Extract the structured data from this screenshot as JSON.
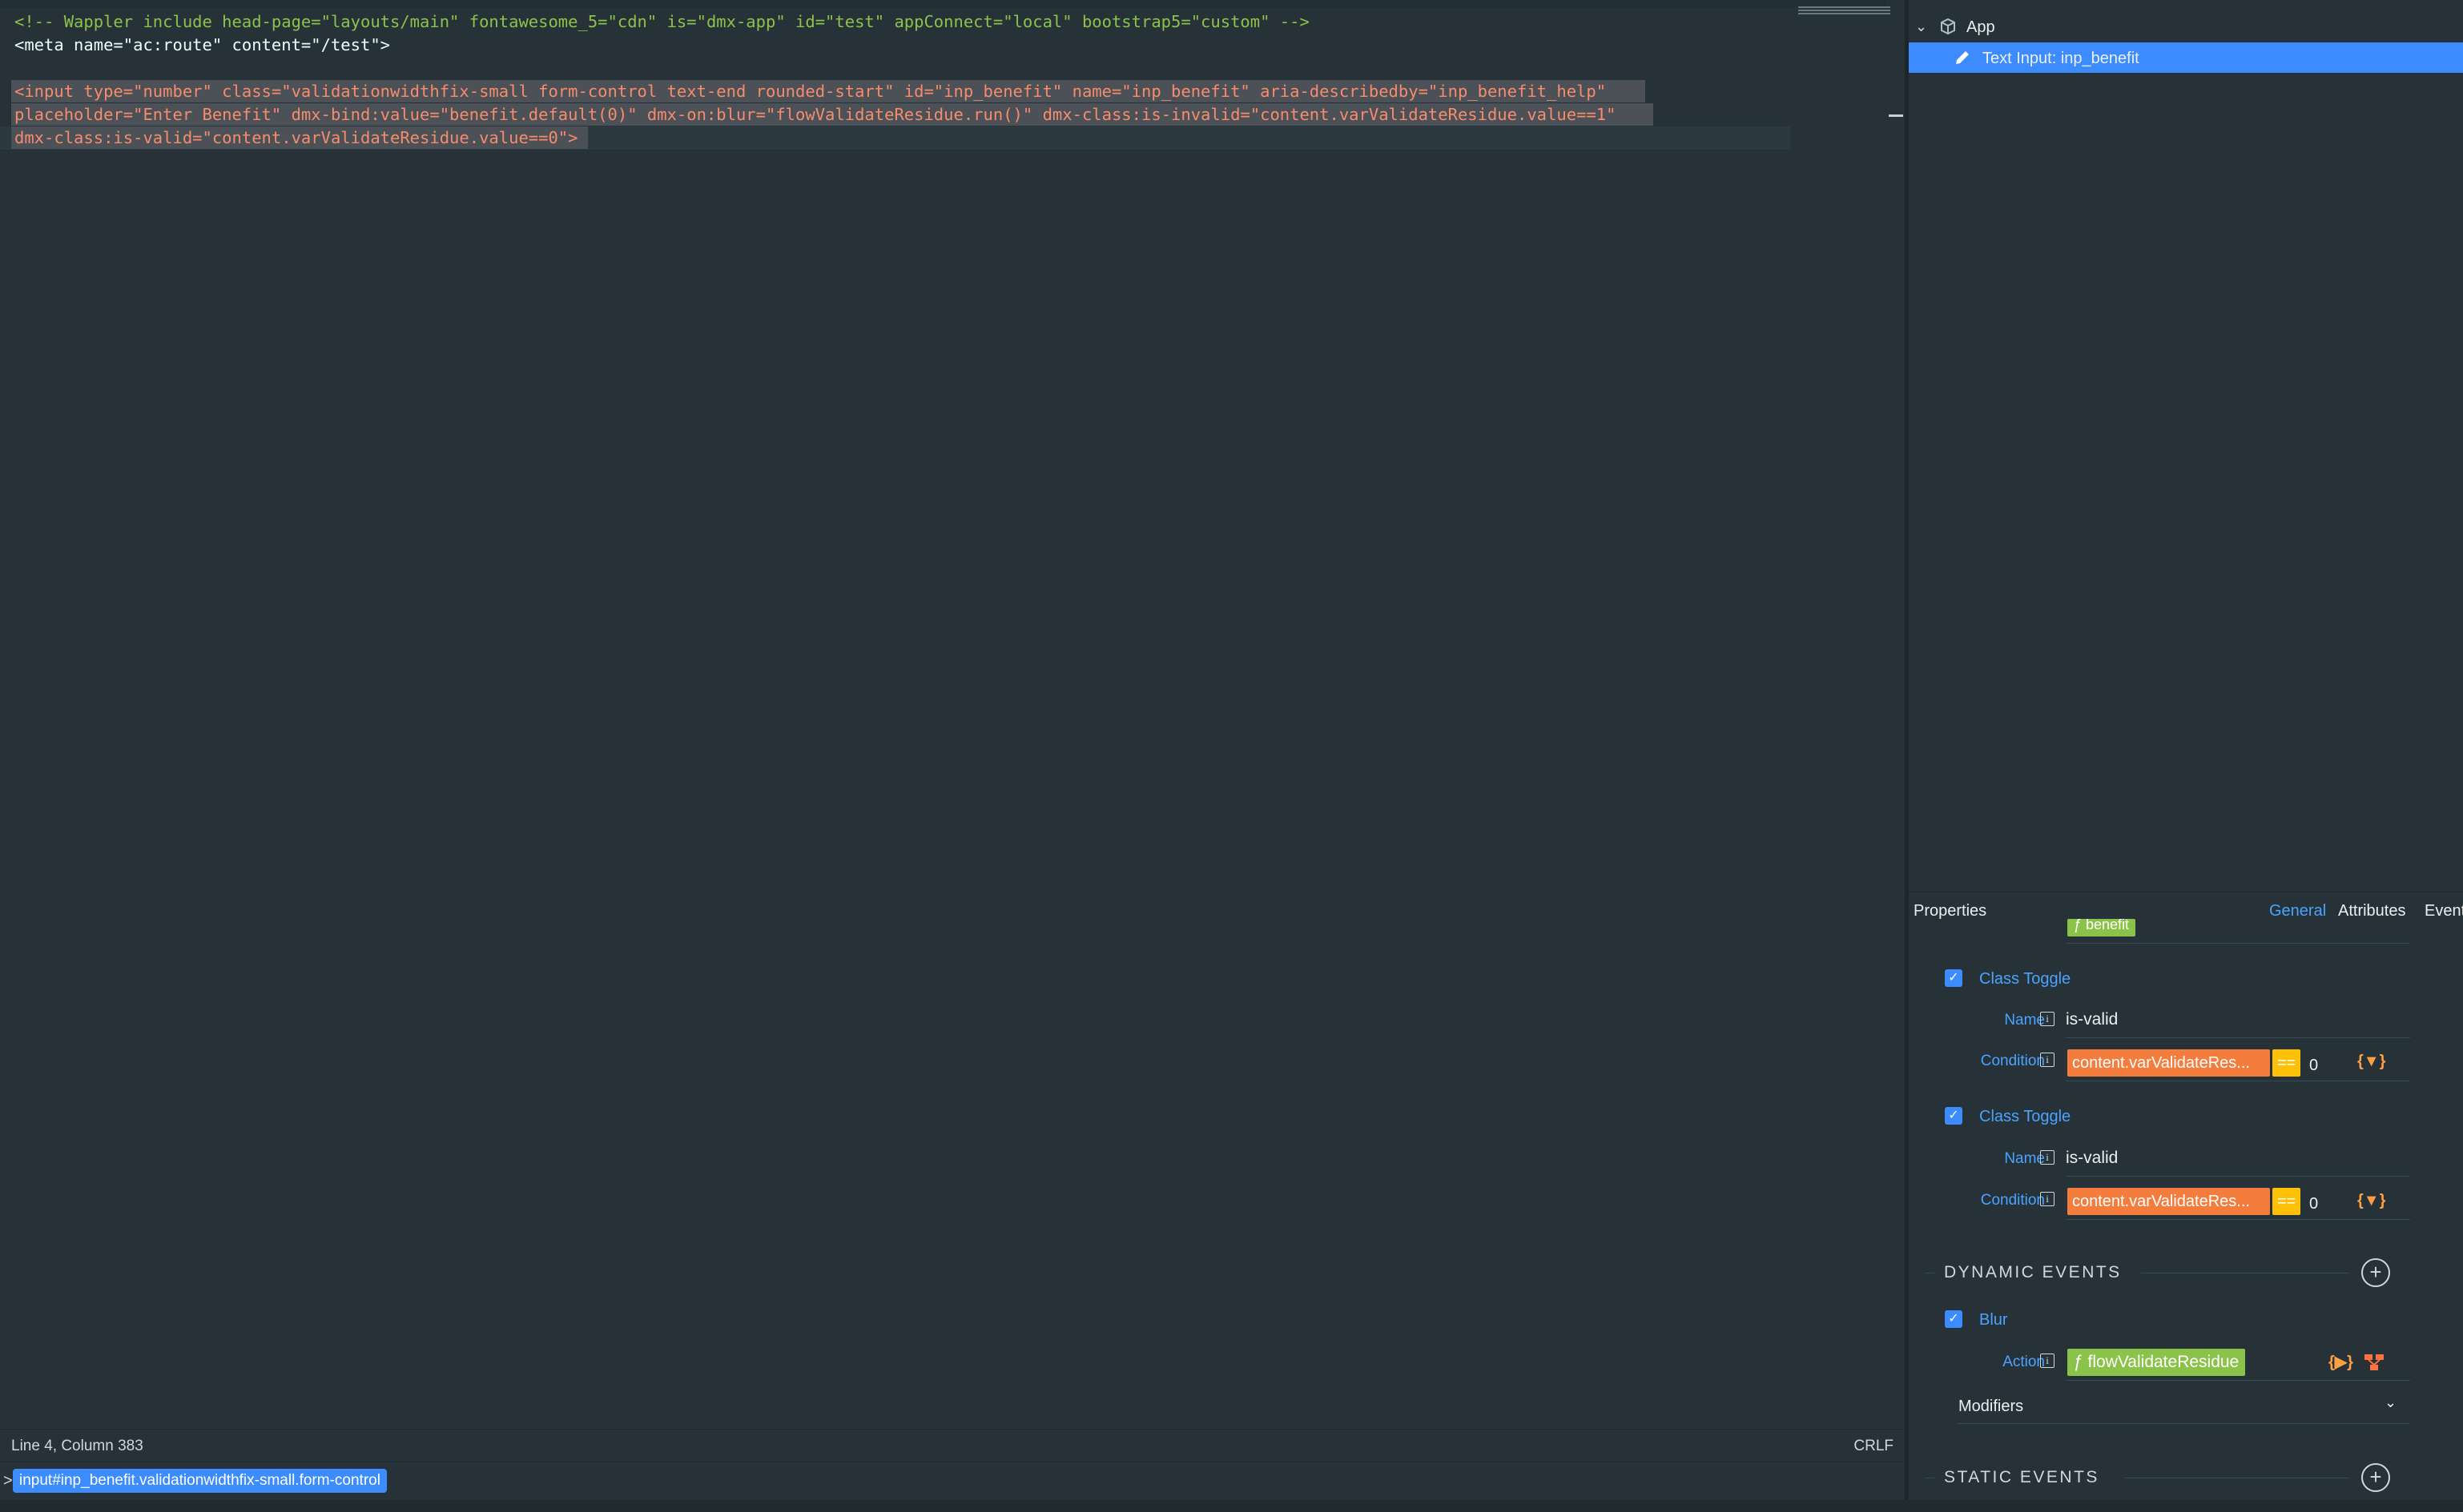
{
  "editor": {
    "lines": {
      "l1_comment": "<!-- Wappler include head-page=\"layouts/main\" fontawesome_5=\"cdn\" is=\"dmx-app\" id=\"test\" appConnect=\"local\" bootstrap5=\"custom\" -->",
      "l2_meta": "<meta name=\"ac:route\" content=\"/test\">",
      "l4a": "<input type=\"number\" class=\"validationwidthfix-small form-control text-end rounded-start\" id=\"inp_benefit\" name=\"inp_benefit\" aria-describedby=\"inp_benefit_help\"",
      "l4b": "placeholder=\"Enter Benefit\" dmx-bind:value=\"benefit.default(0)\" dmx-on:blur=\"flowValidateResidue.run()\" dmx-class:is-invalid=\"content.varValidateResidue.value==1\"",
      "l4c": "dmx-class:is-valid=\"content.varValidateResidue.value==0\">"
    },
    "status": {
      "position": "Line 4, Column 383",
      "eol": "CRLF"
    },
    "breadcrumb": {
      "caret": ">",
      "crumb": "input#inp_benefit.validationwidthfix-small.form-control"
    }
  },
  "tree": {
    "root": {
      "label": "App",
      "icon": "cube-icon"
    },
    "selected": {
      "label": "Text Input: inp_benefit",
      "icon": "pencil-icon"
    }
  },
  "properties": {
    "title": "Properties",
    "tabs": [
      "General",
      "Attributes",
      "Event"
    ],
    "partial_value_chip": "ƒ benefit",
    "class_toggles": [
      {
        "label": "Class Toggle",
        "name_label": "Name",
        "name_value": "is-valid",
        "cond_label": "Condition",
        "cond_chip": "content.varValidateRes...",
        "op": "==",
        "cond_value": "0"
      },
      {
        "label": "Class Toggle",
        "name_label": "Name",
        "name_value": "is-valid",
        "cond_label": "Condition",
        "cond_chip": "content.varValidateRes...",
        "op": "==",
        "cond_value": "0"
      }
    ],
    "dynamic_events": {
      "title": "DYNAMIC EVENTS",
      "event_label": "Blur",
      "action_label": "Action",
      "action_chip": "ƒ flowValidateResidue",
      "modifiers_label": "Modifiers"
    },
    "static_events": {
      "title": "STATIC EVENTS"
    },
    "accent": "#3c8cff"
  }
}
